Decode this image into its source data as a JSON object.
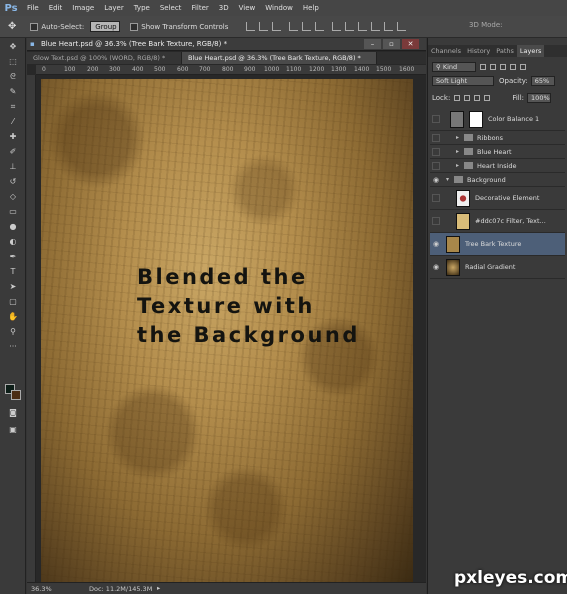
{
  "app": {
    "logo": "Ps"
  },
  "menu": [
    "File",
    "Edit",
    "Image",
    "Layer",
    "Type",
    "Select",
    "Filter",
    "3D",
    "View",
    "Window",
    "Help"
  ],
  "options": {
    "auto_select_label": "Auto-Select:",
    "auto_select_value": "Group",
    "transform_label": "Show Transform Controls",
    "mode_3d_label": "3D Mode:"
  },
  "document": {
    "window_title": "Blue Heart.psd @ 36.3% (Tree Bark Texture, RGB/8) *",
    "tabs": [
      {
        "label": "Glow Text.psd @ 100% (WORD, RGB/8) *"
      },
      {
        "label": "Blue Heart.psd @ 36.3% (Tree Bark Texture, RGB/8) *"
      }
    ],
    "ruler_ticks": [
      "0",
      "100",
      "200",
      "300",
      "400",
      "500",
      "600",
      "700",
      "800",
      "900",
      "1000",
      "1100",
      "1200",
      "1300",
      "1400",
      "1500",
      "1600"
    ],
    "canvas_text": [
      "Blended the",
      "Texture with",
      "the Background"
    ],
    "zoom": "36.3%",
    "doc_size": "Doc: 11.2M/145.3M"
  },
  "panels": {
    "tabs": [
      "Channels",
      "History",
      "Paths",
      "Layers"
    ],
    "kind_label": "Kind",
    "blend_mode": "Soft Light",
    "opacity_label": "Opacity:",
    "opacity_value": "65%",
    "lock_label": "Lock:",
    "fill_label": "Fill:",
    "fill_value": "100%",
    "layers": [
      {
        "name": "Color Balance 1",
        "type": "adjustment",
        "visible": false
      },
      {
        "name": "Ribbons",
        "type": "group",
        "visible": false
      },
      {
        "name": "Blue Heart",
        "type": "group",
        "visible": false
      },
      {
        "name": "Heart Inside",
        "type": "group",
        "visible": false
      },
      {
        "name": "Background",
        "type": "group",
        "visible": true
      },
      {
        "name": "Decorative Element",
        "type": "layer",
        "visible": false
      },
      {
        "name": "#ddc07c Filter, Text...",
        "type": "layer",
        "visible": false
      },
      {
        "name": "Tree Bark Texture",
        "type": "layer",
        "visible": true,
        "selected": true
      },
      {
        "name": "Radial Gradient",
        "type": "layer",
        "visible": true
      }
    ]
  },
  "watermark": "pxleyes.com"
}
